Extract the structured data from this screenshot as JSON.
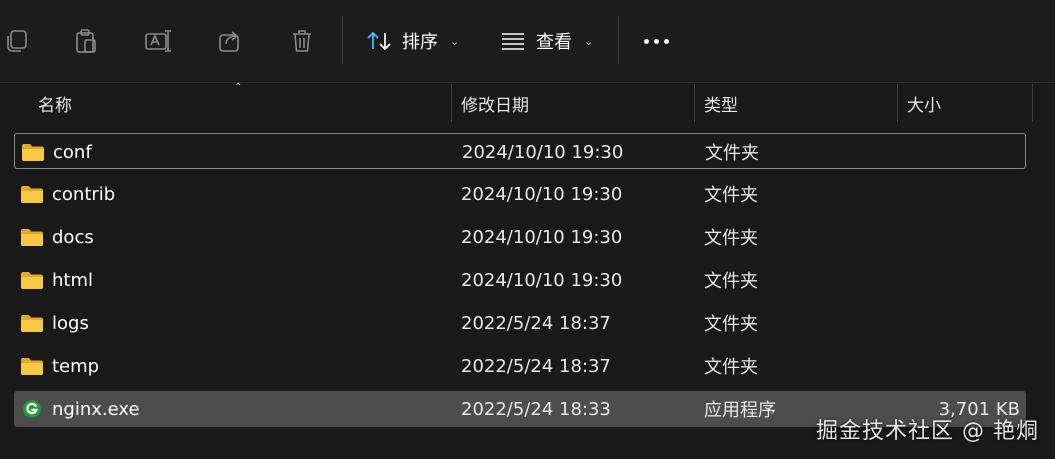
{
  "toolbar": {
    "icons": [
      "copy-icon",
      "paste-icon",
      "rename-icon",
      "share-icon",
      "delete-icon"
    ],
    "sort_label": "排序",
    "view_label": "查看",
    "more_label": "..."
  },
  "columns": {
    "name": "名称",
    "date": "修改日期",
    "type": "类型",
    "size": "大小"
  },
  "files": [
    {
      "name": "conf",
      "date": "2024/10/10 19:30",
      "type": "文件夹",
      "size": "",
      "icon": "folder-icon"
    },
    {
      "name": "contrib",
      "date": "2024/10/10 19:30",
      "type": "文件夹",
      "size": "",
      "icon": "folder-icon"
    },
    {
      "name": "docs",
      "date": "2024/10/10 19:30",
      "type": "文件夹",
      "size": "",
      "icon": "folder-icon"
    },
    {
      "name": "html",
      "date": "2024/10/10 19:30",
      "type": "文件夹",
      "size": "",
      "icon": "folder-icon"
    },
    {
      "name": "logs",
      "date": "2022/5/24 18:37",
      "type": "文件夹",
      "size": "",
      "icon": "folder-icon"
    },
    {
      "name": "temp",
      "date": "2022/5/24 18:37",
      "type": "文件夹",
      "size": "",
      "icon": "folder-icon"
    },
    {
      "name": "nginx.exe",
      "date": "2022/5/24 18:33",
      "type": "应用程序",
      "size": "3,701 KB",
      "icon": "nginx-app-icon"
    }
  ],
  "watermark": "掘金技术社区 @ 艳烔",
  "colors": {
    "background": "#191919",
    "folder": "#f7c843",
    "nginx": "#1f9e3a",
    "accent": "#4cc2ff",
    "selected_row": "#4d4d4d"
  }
}
